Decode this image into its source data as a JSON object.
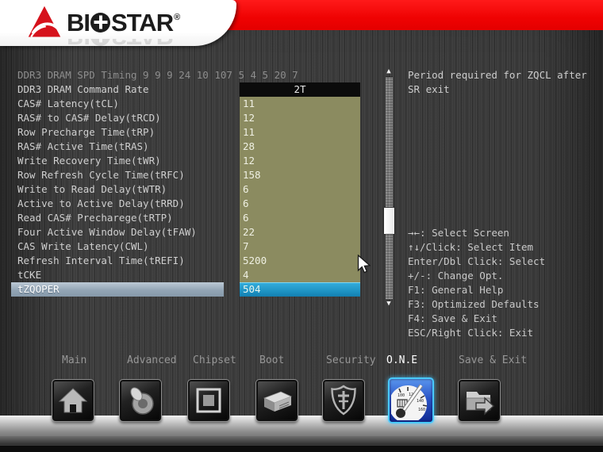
{
  "logo": {
    "brand_left": "BI",
    "brand_right": "STAR",
    "registered": "®"
  },
  "help": {
    "text": "Period required for ZQCL after SR exit"
  },
  "settings": {
    "header": "DDR3 DRAM SPD Timing 9 9 9 24 10 107 5 4 5 20 7",
    "rows": [
      {
        "label": "DDR3 DRAM Command Rate",
        "value": "2T",
        "variant": "dark"
      },
      {
        "label": "CAS# Latency(tCL)",
        "value": "11",
        "variant": "normal"
      },
      {
        "label": "RAS# to CAS# Delay(tRCD)",
        "value": "12",
        "variant": "normal"
      },
      {
        "label": "Row Precharge Time(tRP)",
        "value": "11",
        "variant": "normal"
      },
      {
        "label": "RAS# Active Time(tRAS)",
        "value": "28",
        "variant": "normal"
      },
      {
        "label": "Write Recovery Time(tWR)",
        "value": "12",
        "variant": "normal"
      },
      {
        "label": "Row Refresh Cycle Time(tRFC)",
        "value": "158",
        "variant": "normal"
      },
      {
        "label": "Write to Read Delay(tWTR)",
        "value": "6",
        "variant": "normal"
      },
      {
        "label": "Active to Active Delay(tRRD)",
        "value": "6",
        "variant": "normal"
      },
      {
        "label": "Read CAS# Precharege(tRTP)",
        "value": "6",
        "variant": "normal"
      },
      {
        "label": "Four Active Window Delay(tFAW)",
        "value": "22",
        "variant": "normal"
      },
      {
        "label": "CAS Write Latency(CWL)",
        "value": "7",
        "variant": "normal"
      },
      {
        "label": "Refresh Interval Time(tREFI)",
        "value": "5200",
        "variant": "normal"
      },
      {
        "label": "tCKE",
        "value": "4",
        "variant": "normal"
      },
      {
        "label": "tZQOPER",
        "value": "504",
        "variant": "selected"
      }
    ]
  },
  "scrollbar": {
    "up_arrow": "▲",
    "down_arrow": "▼"
  },
  "hints": [
    "→←: Select Screen",
    "↑↓/Click: Select Item",
    "Enter/Dbl Click: Select",
    "+/-: Change Opt.",
    "F1: General Help",
    "F3: Optimized Defaults",
    "F4: Save & Exit",
    "ESC/Right Click: Exit"
  ],
  "tabs": [
    {
      "label": "Main",
      "active": false
    },
    {
      "label": "Advanced",
      "active": false
    },
    {
      "label": "Chipset",
      "active": false
    },
    {
      "label": "Boot",
      "active": false
    },
    {
      "label": "Security",
      "active": false
    },
    {
      "label": "O.N.E",
      "active": true
    },
    {
      "label": "Save & Exit",
      "active": false
    }
  ],
  "icons": {
    "dock": [
      "home-icon",
      "dish-icon",
      "chip-icon",
      "drive-icon",
      "shield-icon",
      "gauge-icon",
      "folder-exit-icon"
    ]
  },
  "colors": {
    "accent_red": "#ef0202",
    "value_olive": "#8b8b60",
    "selected_cyan": "#1b8fc0",
    "selected_label": "#93a5b5",
    "active_icon_border": "#49c9ff"
  }
}
